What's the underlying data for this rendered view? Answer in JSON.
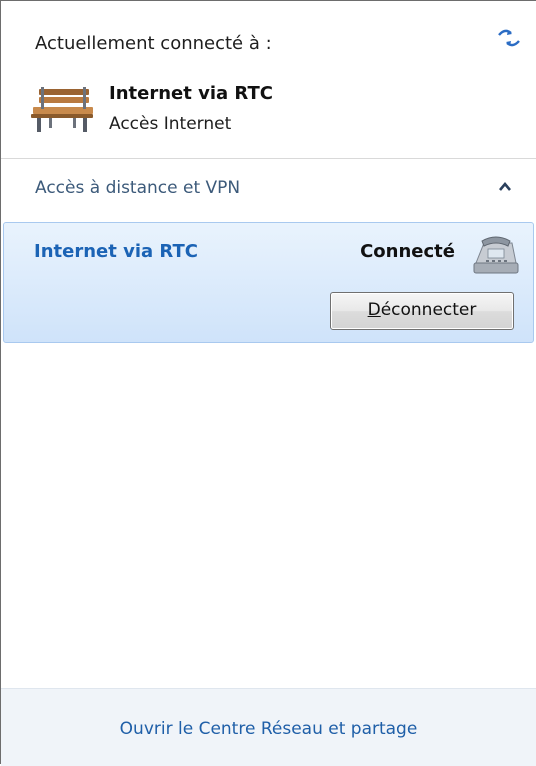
{
  "current": {
    "label": "Actuellement connecté à :",
    "connection_name": "Internet via RTC",
    "connection_type": "Accès Internet",
    "connection_icon": "bench-icon",
    "refresh_icon": "refresh-icon"
  },
  "section": {
    "title": "Accès à distance et VPN",
    "toggle_icon": "chevron-up-icon"
  },
  "vpn_item": {
    "name": "Internet via RTC",
    "status": "Connecté",
    "icon": "phone-icon",
    "button_access_key": "D",
    "button_rest": "éconnecter"
  },
  "footer": {
    "link": "Ouvrir le Centre Réseau et partage"
  },
  "colors": {
    "accent_link": "#1f5fa8",
    "selected_bg": "#d9eafb",
    "selected_border": "#a9c9ef",
    "item_name": "#1b63b5"
  }
}
